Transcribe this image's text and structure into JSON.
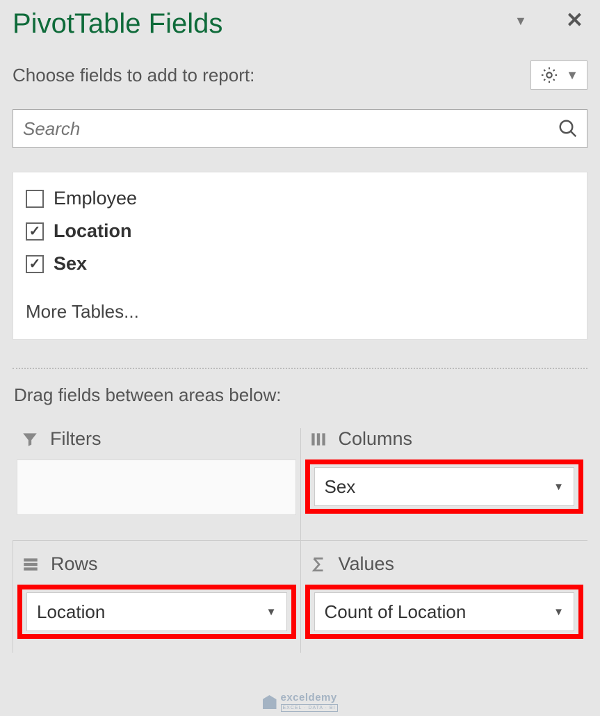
{
  "pane": {
    "title": "PivotTable Fields",
    "subtitle": "Choose fields to add to report:"
  },
  "search": {
    "placeholder": "Search"
  },
  "fields": {
    "items": [
      {
        "label": "Employee",
        "checked": false,
        "bold": false
      },
      {
        "label": "Location",
        "checked": true,
        "bold": true
      },
      {
        "label": "Sex",
        "checked": true,
        "bold": true
      }
    ],
    "more": "More Tables..."
  },
  "drag": {
    "label": "Drag fields between areas below:"
  },
  "areas": {
    "filters": {
      "title": "Filters"
    },
    "columns": {
      "title": "Columns",
      "item": "Sex"
    },
    "rows": {
      "title": "Rows",
      "item": "Location"
    },
    "values": {
      "title": "Values",
      "item": "Count of Location"
    }
  },
  "watermark": {
    "brand": "exceldemy",
    "tagline": "EXCEL · DATA · BI"
  }
}
